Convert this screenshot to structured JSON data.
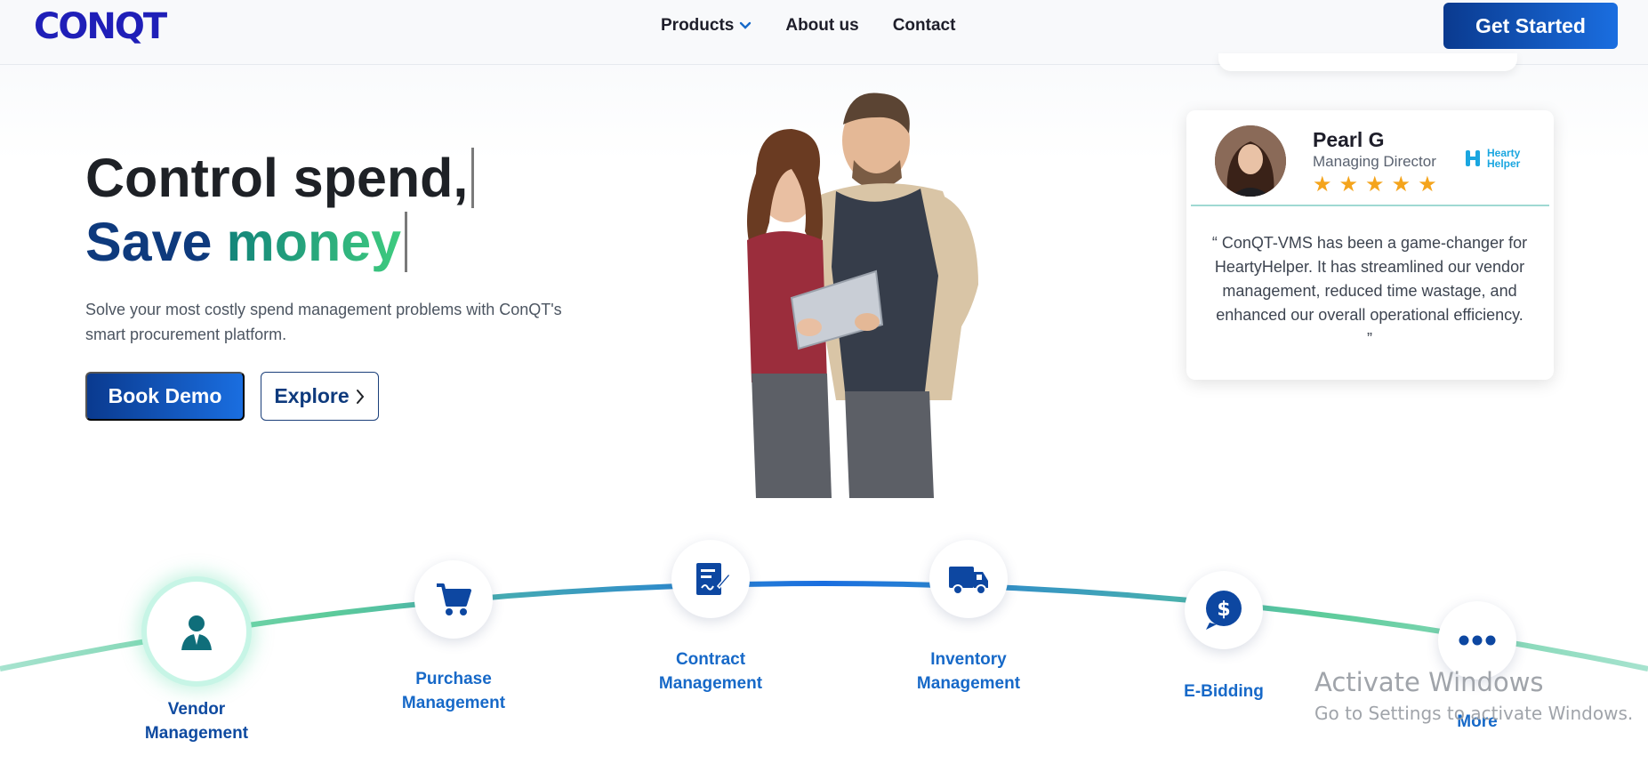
{
  "header": {
    "logo_text": "CONQT",
    "nav": [
      {
        "label": "Products",
        "has_dropdown": true
      },
      {
        "label": "About us"
      },
      {
        "label": "Contact"
      }
    ],
    "cta_label": "Get Started"
  },
  "hero": {
    "headline_line1": "Control spend,",
    "headline_line2_a": "Save",
    "headline_line2_b": "money",
    "subtext": "Solve your most costly spend management problems with ConQT's smart procurement platform.",
    "primary_button": "Book Demo",
    "secondary_button": "Explore"
  },
  "testimonial": {
    "name": "Pearl G",
    "role": "Managing Director",
    "rating": 5,
    "brand_line1": "Hearty",
    "brand_line2": "Helper",
    "quote": "“ ConQT-VMS has been a game-changer for HeartyHelper. It has streamlined our vendor management, reduced time wastage, and enhanced our overall operational efficiency. ”"
  },
  "modules": [
    {
      "label_line1": "Vendor",
      "label_line2": "Management",
      "icon": "vendor-user-icon",
      "active": true
    },
    {
      "label_line1": "Purchase",
      "label_line2": "Management",
      "icon": "cart-icon"
    },
    {
      "label_line1": "Contract",
      "label_line2": "Management",
      "icon": "contract-icon"
    },
    {
      "label_line1": "Inventory",
      "label_line2": "Management",
      "icon": "truck-icon"
    },
    {
      "label_line1": "E-Bidding",
      "label_line2": "",
      "icon": "dollar-bubble-icon"
    },
    {
      "label_line1": "More",
      "label_line2": "",
      "icon": "ellipsis-icon"
    }
  ],
  "watermark": {
    "title": "Activate Windows",
    "subtitle": "Go to Settings to activate Windows."
  },
  "colors": {
    "brand_navy": "#0e3a7d",
    "brand_blue": "#1a6ee0",
    "accent_green": "#3ecb7f",
    "star": "#f4a41c"
  }
}
